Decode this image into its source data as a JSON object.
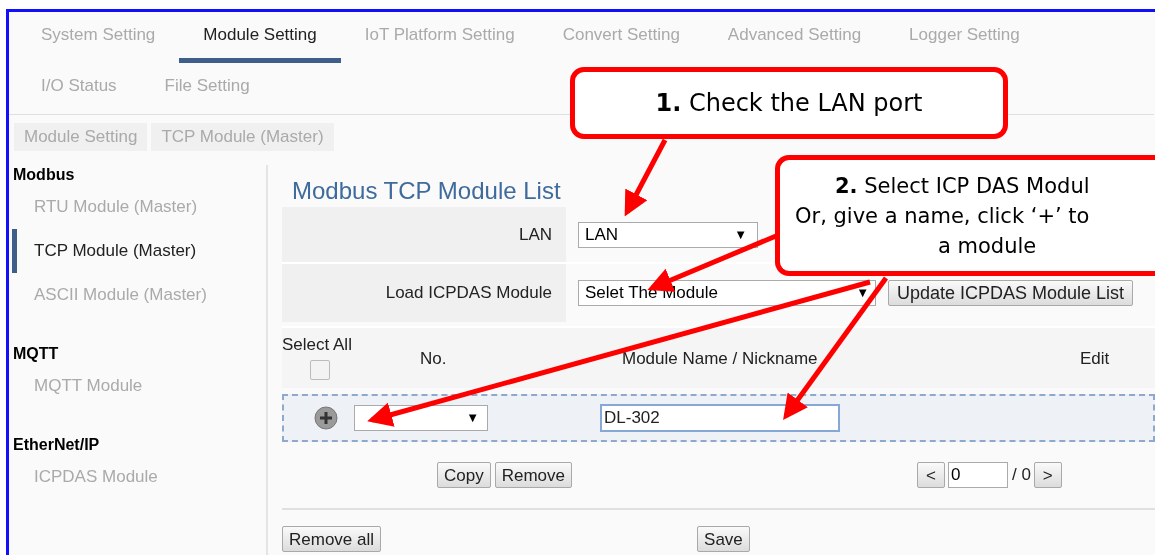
{
  "nav_rows": [
    {
      "tabs": [
        {
          "label": "System Setting",
          "selected": false
        },
        {
          "label": "Module Setting",
          "selected": true
        },
        {
          "label": "IoT Platform Setting",
          "selected": false
        },
        {
          "label": "Convert Setting",
          "selected": false
        },
        {
          "label": "Advanced Setting",
          "selected": false
        },
        {
          "label": "Logger Setting",
          "selected": false
        }
      ]
    },
    {
      "tabs": [
        {
          "label": "I/O Status",
          "selected": false
        },
        {
          "label": "File Setting",
          "selected": false
        }
      ]
    }
  ],
  "breadcrumb": [
    "Module Setting",
    "TCP Module (Master)"
  ],
  "sidebar": {
    "groups": [
      {
        "title": "Modbus",
        "items": [
          {
            "label": "RTU Module (Master)",
            "selected": false
          },
          {
            "label": "TCP Module (Master)",
            "selected": true
          },
          {
            "label": "ASCII Module (Master)",
            "selected": false
          }
        ]
      },
      {
        "title": "MQTT",
        "items": [
          {
            "label": "MQTT Module",
            "selected": false
          }
        ]
      },
      {
        "title": "EtherNet/IP",
        "items": [
          {
            "label": "ICPDAS Module",
            "selected": false
          }
        ]
      }
    ]
  },
  "content": {
    "title": "Modbus TCP Module List",
    "lan": {
      "label": "LAN",
      "value": "LAN",
      "arrow": "▼"
    },
    "load": {
      "label": "Load ICPDAS Module",
      "value": "Selet The Module",
      "arrow": "▼",
      "button": "Update ICPDAS Module List"
    },
    "table": {
      "select_all": {
        "label": "Select All",
        "checked": false
      },
      "columns": [
        "No.",
        "Module Name / Nickname",
        "Edit"
      ],
      "new_row": {
        "number_arrow": "▼",
        "name": "DL-302"
      }
    },
    "actions": [
      "Copy",
      "Remove"
    ],
    "pager": {
      "prev": "<",
      "value": "0",
      "total": "/ 0",
      "next": ">"
    },
    "bottom_buttons": [
      "Remove all",
      "Save"
    ]
  },
  "callouts": [
    {
      "lines": [
        "**1.** Check the LAN port"
      ]
    },
    {
      "lines": [
        "**2.** Select ICP DAS Modul",
        "Or, give a name, click ‘+’ to",
        "a module"
      ]
    }
  ]
}
